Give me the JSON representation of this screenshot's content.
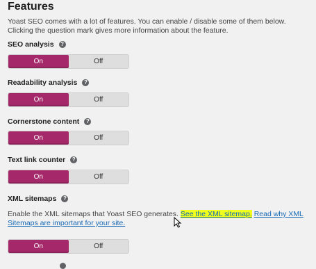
{
  "section": {
    "title": "Features",
    "intro": "Yoast SEO comes with a lot of features. You can enable / disable some of them below. Clicking the question mark gives more information about the feature."
  },
  "features": [
    {
      "label": "SEO analysis",
      "on_label": "On",
      "off_label": "Off",
      "state": "on"
    },
    {
      "label": "Readability analysis",
      "on_label": "On",
      "off_label": "Off",
      "state": "on"
    },
    {
      "label": "Cornerstone content",
      "on_label": "On",
      "off_label": "Off",
      "state": "on"
    },
    {
      "label": "Text link counter",
      "on_label": "On",
      "off_label": "Off",
      "state": "on"
    },
    {
      "label": "XML sitemaps",
      "on_label": "On",
      "off_label": "Off",
      "state": "on"
    }
  ],
  "help_glyph": "?",
  "xml": {
    "desc": "Enable the XML sitemaps that Yoast SEO generates.",
    "link1": "See the XML sitemap.",
    "link2": "Read why XML Sitemaps are important for your site."
  },
  "colors": {
    "accent": "#a4286a",
    "link": "#1569b5",
    "highlight": "#f0ff1e"
  }
}
